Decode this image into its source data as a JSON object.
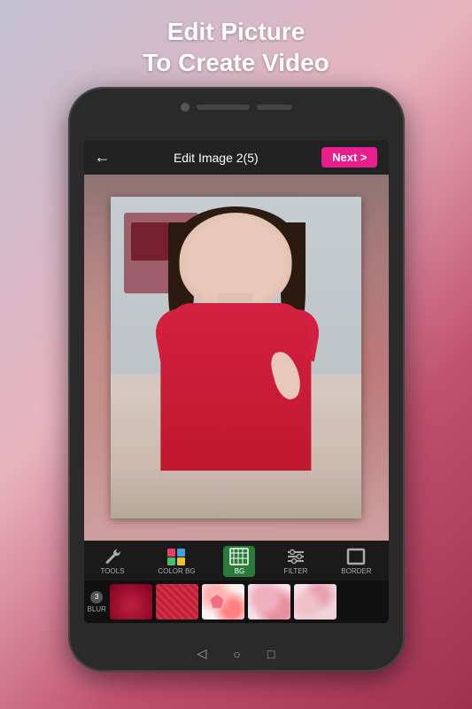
{
  "title": {
    "line1": "Edit Picture",
    "line2": "To Create Video"
  },
  "header": {
    "back_icon": "←",
    "title": "Edit Image 2(5)",
    "next_label": "Next >"
  },
  "tools": [
    {
      "id": "tools",
      "label": "TOOLS",
      "active": false
    },
    {
      "id": "color_bg",
      "label": "COLOR BG",
      "active": false
    },
    {
      "id": "bg",
      "label": "BG",
      "active": true
    },
    {
      "id": "filter",
      "label": "FILTER",
      "active": false
    },
    {
      "id": "border",
      "label": "BORDER",
      "active": false
    }
  ],
  "blur": {
    "count": "3",
    "label": "BLUR"
  },
  "nav": {
    "back": "◁",
    "home": "○",
    "recents": "□"
  },
  "colors": {
    "next_btn": "#e91e8c",
    "active_tool": "#2a7a3a",
    "header_bg": "#222222"
  }
}
